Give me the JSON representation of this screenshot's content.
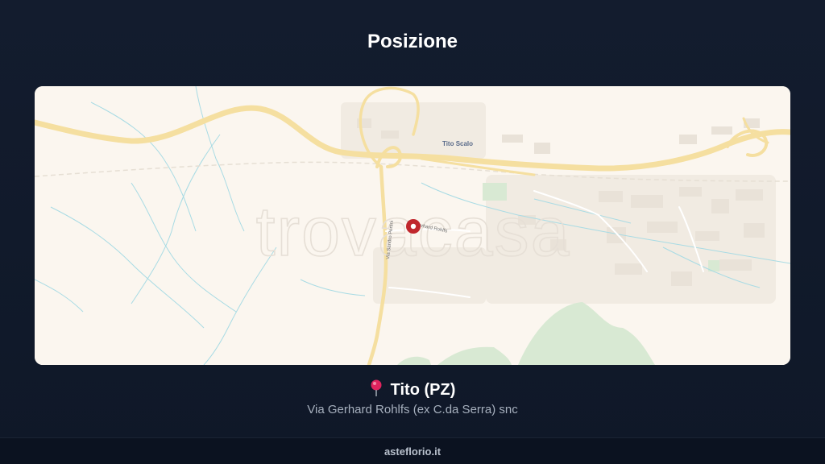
{
  "header": {
    "title": "Posizione"
  },
  "map": {
    "watermark": "trovacasa",
    "labels": {
      "locality": "Tito Scalo",
      "street_vertical": "Via Sandro Pertini",
      "street_marker": "Via Gerhard Rohlfs"
    },
    "marker_icon": "map-pin-icon",
    "marker_color": "#c0272d",
    "road_color": "#f5dfa0",
    "water_color": "#9fd6e0",
    "park_color": "#cfe5cc"
  },
  "location": {
    "pin_icon": "round-pushpin-icon",
    "city": "Tito (PZ)",
    "address": "Via Gerhard Rohlfs (ex C.da Serra) snc"
  },
  "footer": {
    "site": "asteflorio.it"
  }
}
